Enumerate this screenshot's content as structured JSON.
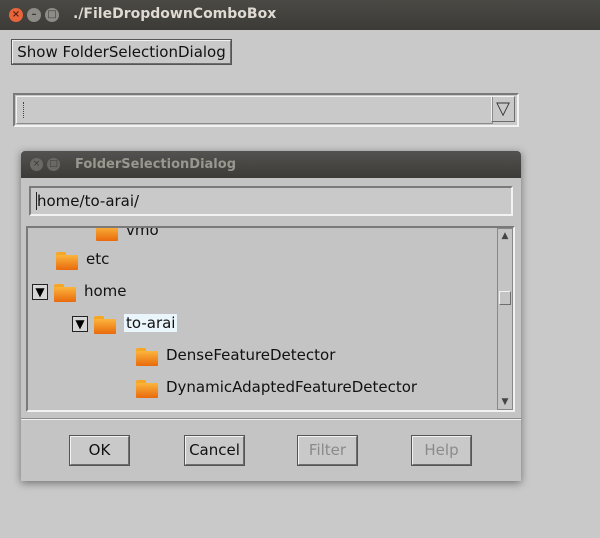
{
  "window": {
    "title": "./FileDropdownComboBox"
  },
  "main": {
    "show_button_label": "Show FolderSelectionDialog",
    "combo_value": "",
    "combo_arrow_glyph": "▽"
  },
  "dialog": {
    "title": "FolderSelectionDialog",
    "path_value": "home/to-arai/",
    "tree": [
      {
        "label": "vmo",
        "expanded": null,
        "selected": false
      },
      {
        "label": "etc",
        "expanded": null,
        "selected": false
      },
      {
        "label": "home",
        "expanded": true,
        "selected": false
      },
      {
        "label": "to-arai",
        "expanded": true,
        "selected": true
      },
      {
        "label": "DenseFeatureDetector",
        "expanded": null,
        "selected": false
      },
      {
        "label": "DynamicAdaptedFeatureDetector",
        "expanded": null,
        "selected": false
      }
    ],
    "buttons": {
      "ok": "OK",
      "cancel": "Cancel",
      "filter": "Filter",
      "help": "Help"
    },
    "expander_glyph": "▼"
  },
  "colors": {
    "background": "#c9c9c9",
    "titlebar": "#3c3b37",
    "close_button": "#e8643a",
    "folder": "#f7941d",
    "selection": "#eaf6fb"
  }
}
